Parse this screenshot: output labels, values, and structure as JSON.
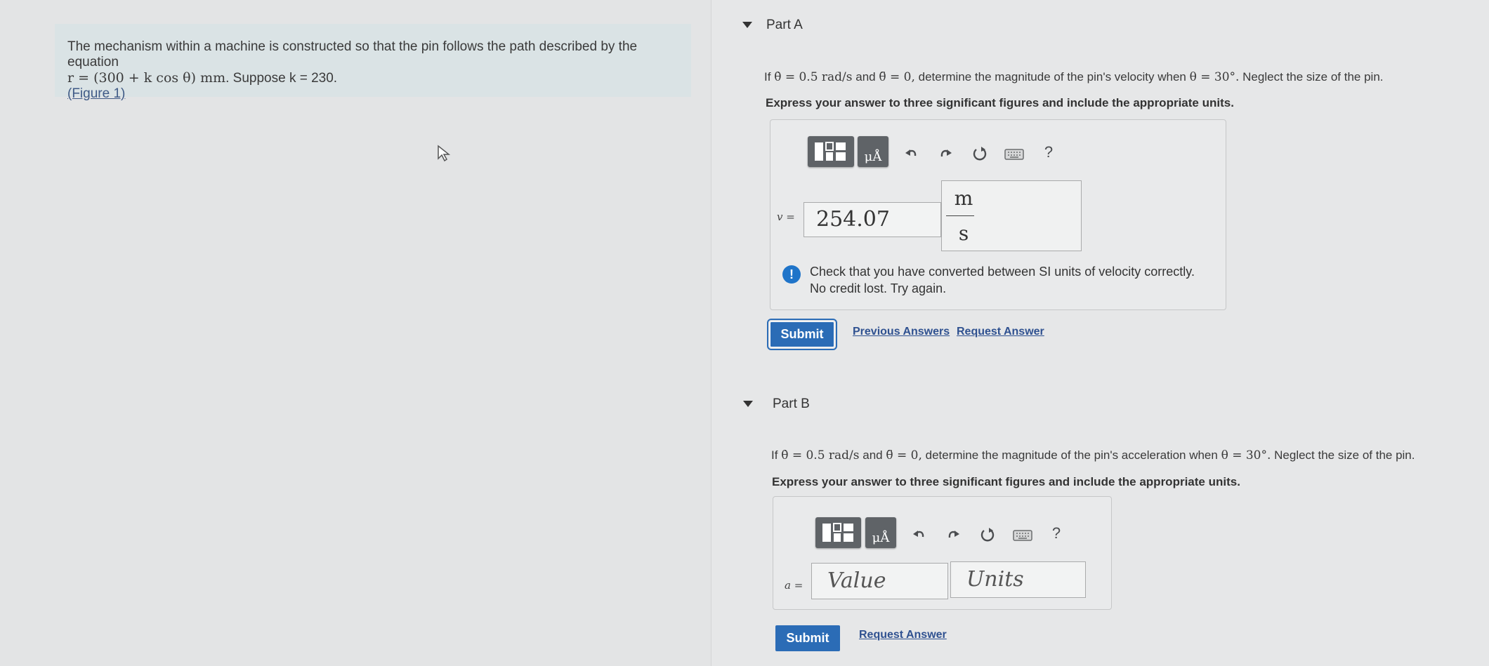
{
  "problem": {
    "line1": "The mechanism within a machine is constructed so that the pin follows the path described by the equation",
    "equation": "r = (300 + k cos θ) mm",
    "suppose": "Suppose k = 230.",
    "figure_link": "(Figure 1)"
  },
  "partA": {
    "title": "Part A",
    "question_prefix": "If",
    "question_given1": "θ̇ = 0.5 rad/s",
    "question_and": "and",
    "question_given2": "θ̈ = 0,",
    "question_main": "determine the magnitude of the pin's velocity when",
    "question_angle": "θ = 30°.",
    "question_suffix": "Neglect the size of the pin.",
    "instruction": "Express your answer to three significant figures and include the appropriate units.",
    "variable": "v =",
    "value": "254.07",
    "units_numerator": "m",
    "units_denominator": "s",
    "feedback_line1": "Check that you have converted between SI units of velocity correctly.",
    "feedback_line2": "No credit lost. Try again.",
    "submit_label": "Submit",
    "previous_answers_label": "Previous Answers",
    "request_answer_label": "Request Answer"
  },
  "partB": {
    "title": "Part B",
    "question_prefix": "If",
    "question_given1": "θ̇ = 0.5 rad/s",
    "question_and": "and",
    "question_given2": "θ̈ = 0,",
    "question_main": "determine the magnitude of the pin's acceleration when",
    "question_angle": "θ = 30°.",
    "question_suffix": "Neglect the size of the pin.",
    "instruction": "Express your answer to three significant figures and include the appropriate units.",
    "variable": "a =",
    "value_placeholder": "Value",
    "units_placeholder": "Units",
    "submit_label": "Submit",
    "request_answer_label": "Request Answer"
  },
  "toolbar": {
    "help_label": "?",
    "units_button_text": "μÅ"
  },
  "colors": {
    "accent": "#2b6cb6",
    "feedback_icon": "#1f74c9",
    "link": "#2f5190"
  },
  "icons": [
    "templates-icon",
    "units-icon",
    "undo-icon",
    "redo-icon",
    "reset-icon",
    "keyboard-icon",
    "help-icon",
    "alert-icon",
    "cursor-icon",
    "caret-down-icon"
  ]
}
